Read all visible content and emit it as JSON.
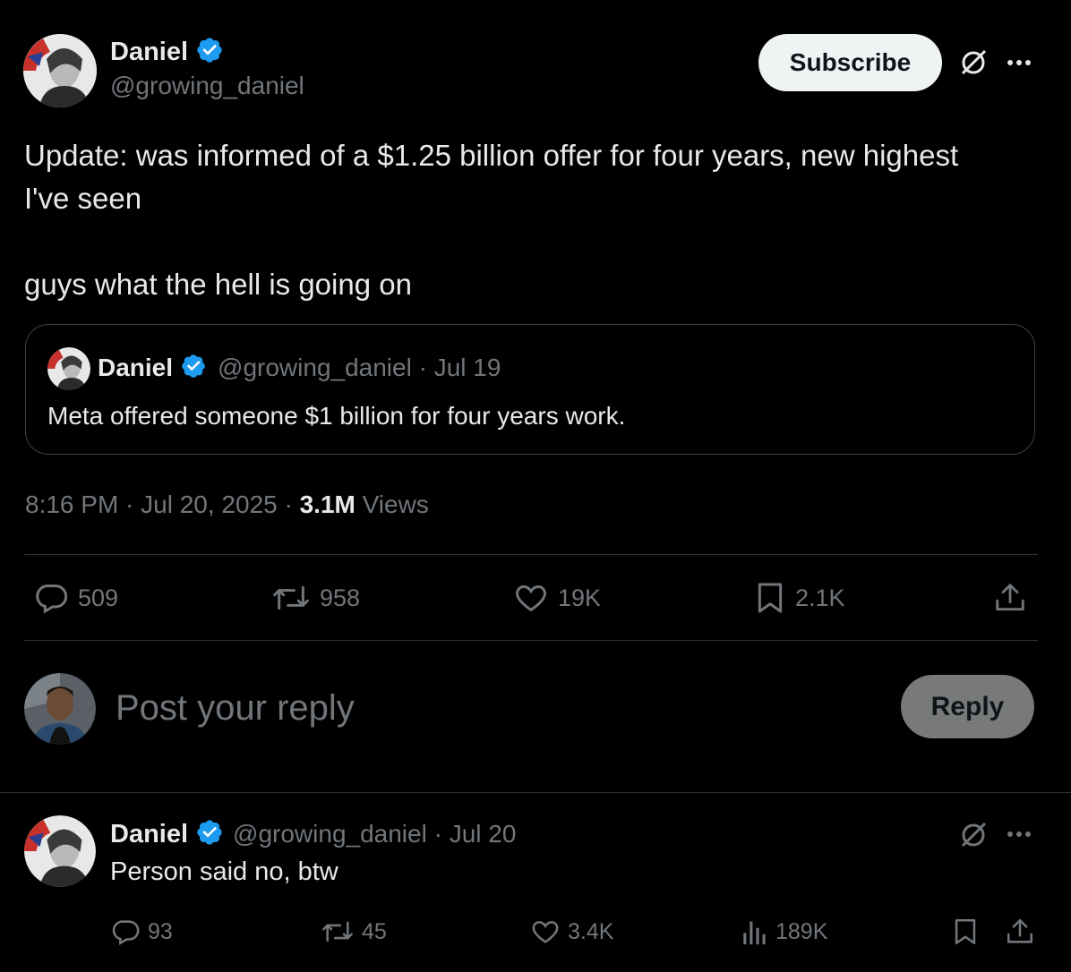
{
  "main_tweet": {
    "author_name": "Daniel",
    "handle": "@growing_daniel",
    "subscribe_label": "Subscribe",
    "text_line1": "Update: was informed of a $1.25 billion offer for four years, new highest",
    "text_line2": "I've seen",
    "text_line3": "guys what the hell is going on",
    "quoted": {
      "author_name": "Daniel",
      "handle_date": "@growing_daniel · Jul 19",
      "text": "Meta offered someone $1 billion for four years work."
    },
    "meta_time": "8:16 PM · Jul 20, 2025 · ",
    "views_count": "3.1M",
    "views_label": "Views",
    "stats": {
      "replies": "509",
      "reposts": "958",
      "likes": "19K",
      "bookmarks": "2.1K"
    }
  },
  "reply_box": {
    "placeholder": "Post your reply",
    "button_label": "Reply"
  },
  "reply_tweet": {
    "author_name": "Daniel",
    "handle_date": "@growing_daniel · Jul 20",
    "text": "Person said no, btw",
    "stats": {
      "replies": "93",
      "reposts": "45",
      "likes": "3.4K",
      "views": "189K"
    }
  },
  "colors": {
    "background": "#000000",
    "text": "#e7e9ea",
    "muted": "#71767b",
    "verified": "#1d9bf0",
    "divider": "#2f3336"
  }
}
